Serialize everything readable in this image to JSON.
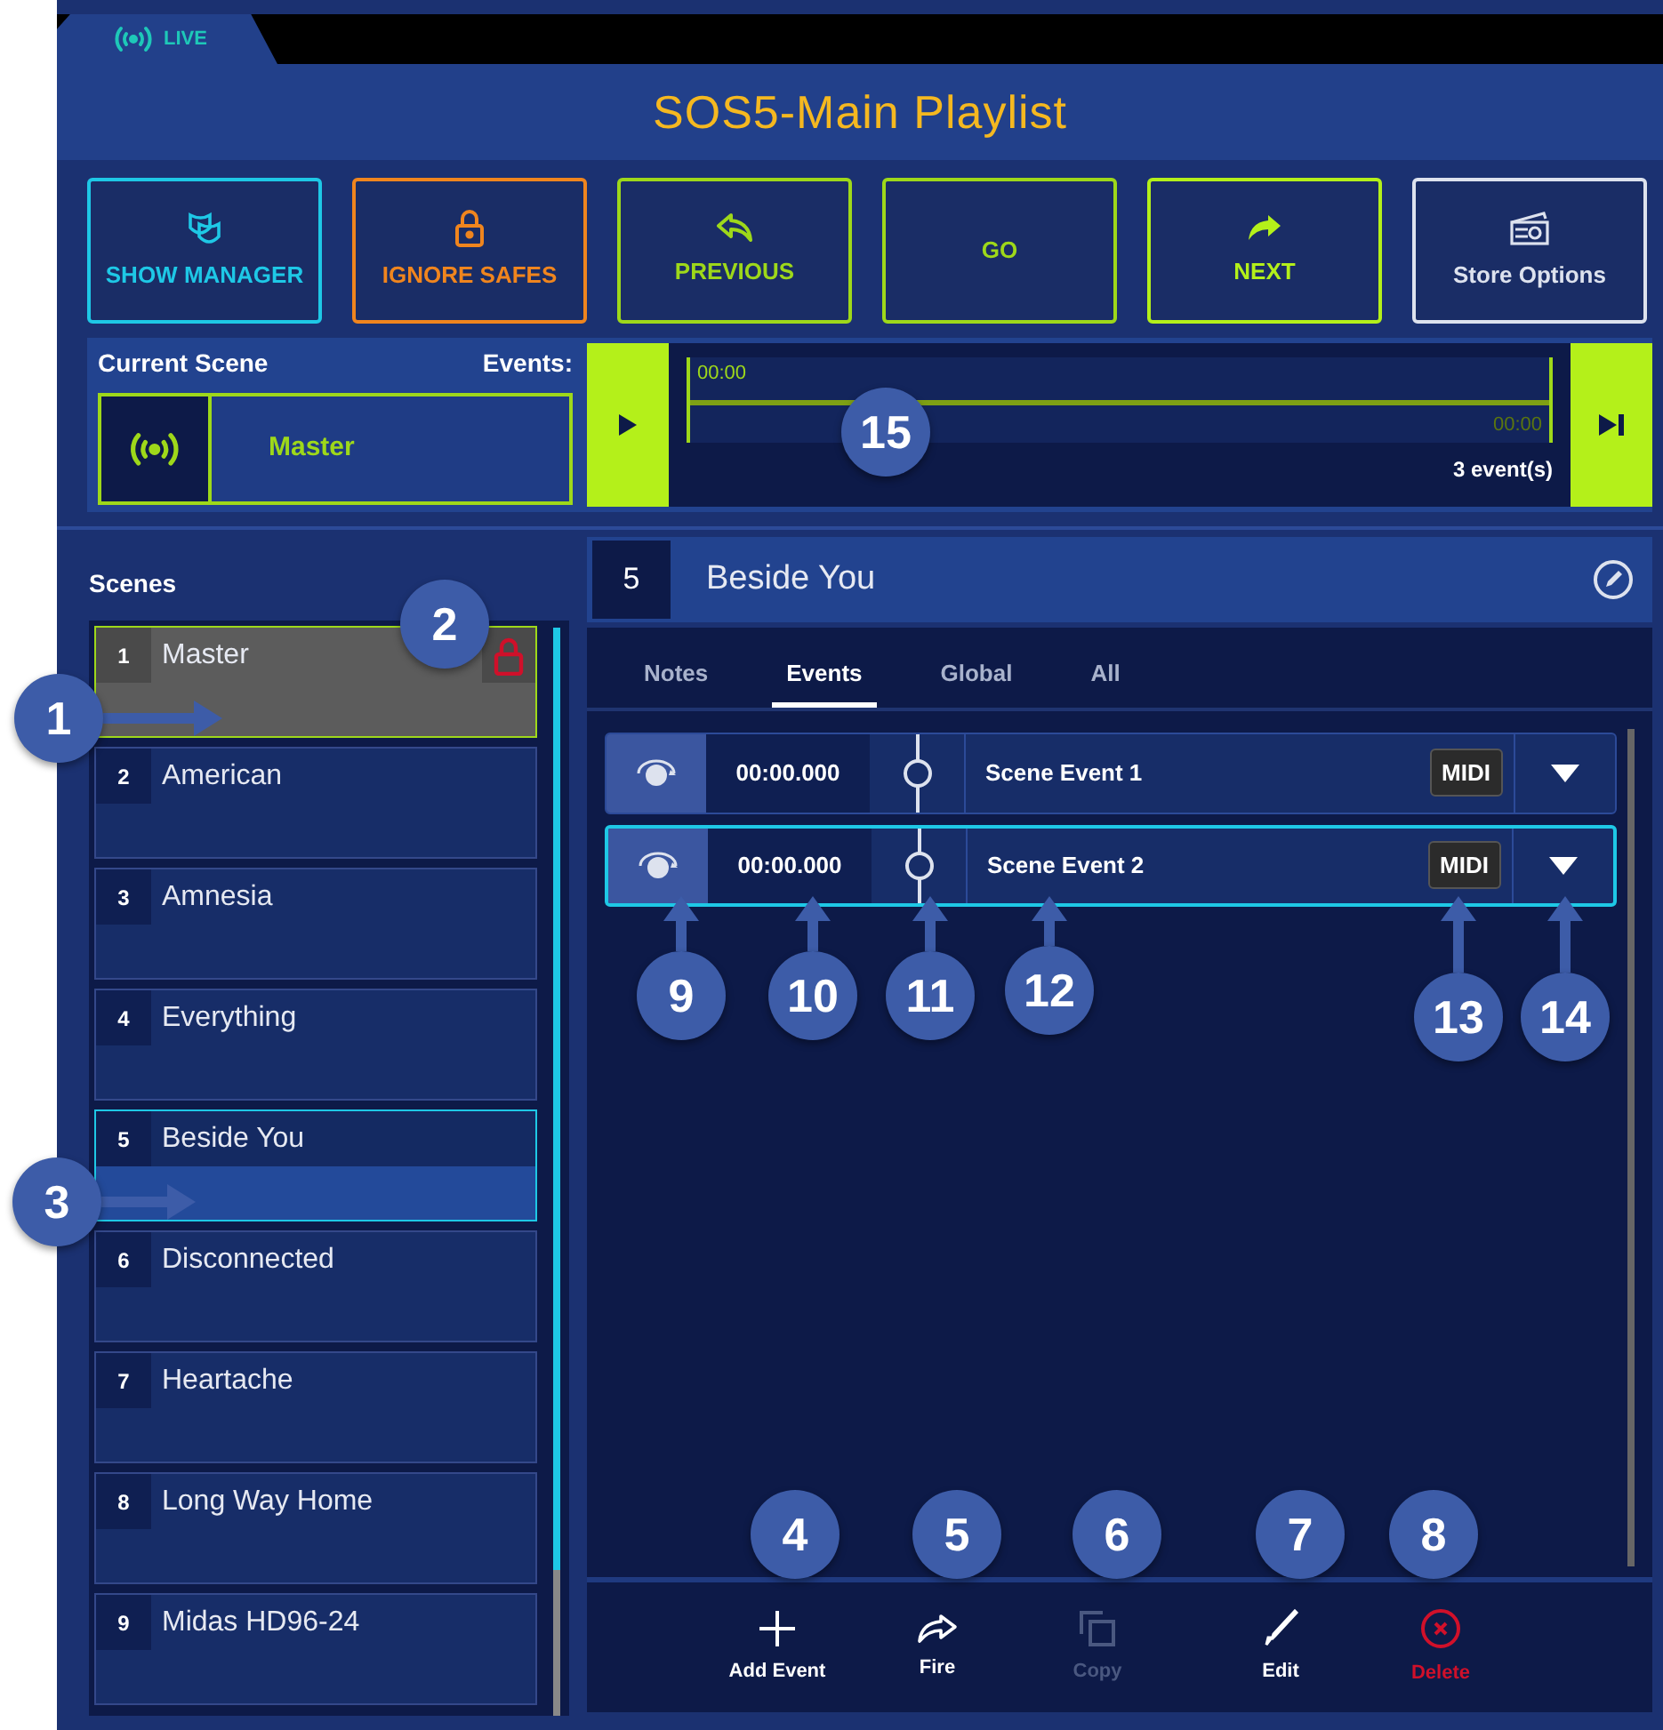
{
  "live_tab": {
    "label": "LIVE"
  },
  "title": "SOS5-Main Playlist",
  "toolbar": [
    {
      "kind": "masks",
      "label": "SHOW MANAGER",
      "color": "#1ec8e6"
    },
    {
      "kind": "lock",
      "label": "IGNORE SAFES",
      "color": "#f0851e"
    },
    {
      "kind": "back",
      "label": "PREVIOUS",
      "color": "#9ed81a"
    },
    {
      "kind": "none",
      "label": "GO",
      "color": "#9ed81a"
    },
    {
      "kind": "forward",
      "label": "NEXT",
      "color": "#b4f01a"
    },
    {
      "kind": "clapper",
      "label": "Store Options",
      "color": "#dde2ee"
    }
  ],
  "current_scene": {
    "heading": "Current Scene",
    "events_label": "Events:",
    "name": "Master"
  },
  "timeline": {
    "start": "00:00",
    "end": "00:00",
    "count": "3 event(s)"
  },
  "scenes_heading": "Scenes",
  "scenes": [
    {
      "number": "1",
      "name": "Master",
      "current": true,
      "locked": true,
      "selected": false
    },
    {
      "number": "2",
      "name": "American",
      "current": false,
      "locked": false,
      "selected": false
    },
    {
      "number": "3",
      "name": "Amnesia",
      "current": false,
      "locked": false,
      "selected": false
    },
    {
      "number": "4",
      "name": "Everything",
      "current": false,
      "locked": false,
      "selected": false
    },
    {
      "number": "5",
      "name": "Beside You",
      "current": false,
      "locked": false,
      "selected": true
    },
    {
      "number": "6",
      "name": "Disconnected",
      "current": false,
      "locked": false,
      "selected": false
    },
    {
      "number": "7",
      "name": "Heartache",
      "current": false,
      "locked": false,
      "selected": false
    },
    {
      "number": "8",
      "name": "Long Way Home",
      "current": false,
      "locked": false,
      "selected": false
    },
    {
      "number": "9",
      "name": "Midas HD96-24",
      "current": false,
      "locked": false,
      "selected": false
    }
  ],
  "detail": {
    "number": "5",
    "title": "Beside You"
  },
  "tabs": [
    {
      "label": "Notes",
      "selected": false
    },
    {
      "label": "Events",
      "selected": true
    },
    {
      "label": "Global",
      "selected": false
    },
    {
      "label": "All",
      "selected": false
    }
  ],
  "events": [
    {
      "time": "00:00.000",
      "name": "Scene Event 1",
      "type": "MIDI",
      "selected": false
    },
    {
      "time": "00:00.000",
      "name": "Scene Event 2",
      "type": "MIDI",
      "selected": true
    }
  ],
  "actions": [
    {
      "kind": "add",
      "label": "Add Event",
      "disabled": false
    },
    {
      "kind": "fire",
      "label": "Fire",
      "disabled": false
    },
    {
      "kind": "copy",
      "label": "Copy",
      "disabled": true
    },
    {
      "kind": "edit",
      "label": "Edit",
      "disabled": false
    },
    {
      "kind": "delete",
      "label": "Delete",
      "disabled": false
    }
  ],
  "callouts": [
    {
      "label": "1",
      "kind": "right"
    },
    {
      "label": "2",
      "kind": "plain"
    },
    {
      "label": "3",
      "kind": "right"
    },
    {
      "label": "4",
      "kind": "plain"
    },
    {
      "label": "5",
      "kind": "plain"
    },
    {
      "label": "6",
      "kind": "plain"
    },
    {
      "label": "7",
      "kind": "plain"
    },
    {
      "label": "8",
      "kind": "plain"
    },
    {
      "label": "9",
      "kind": "up"
    },
    {
      "label": "10",
      "kind": "up"
    },
    {
      "label": "11",
      "kind": "up"
    },
    {
      "label": "12",
      "kind": "up"
    },
    {
      "label": "13",
      "kind": "up"
    },
    {
      "label": "14",
      "kind": "up"
    },
    {
      "label": "15",
      "kind": "plain"
    }
  ]
}
